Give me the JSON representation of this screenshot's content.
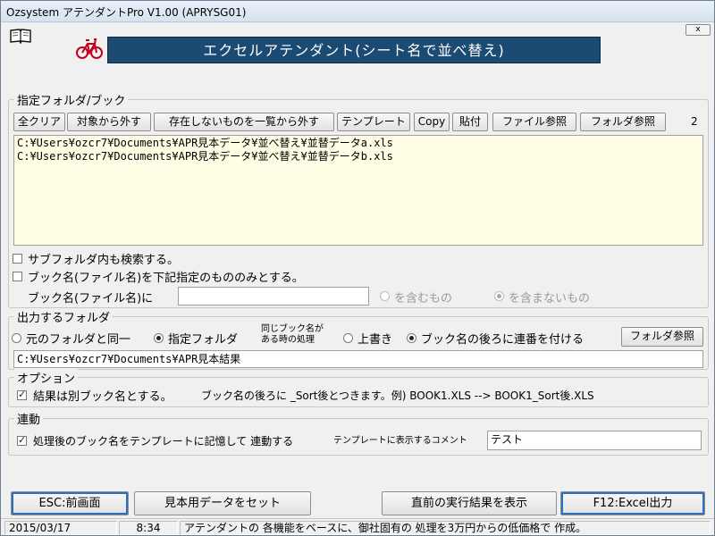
{
  "window": {
    "title": "Ozsystem アテンダントPro V1.00 (APRYSG01)",
    "close_label": "x"
  },
  "banner": {
    "title": "エクセルアテンダント(シート名で並べ替え)"
  },
  "icons": {
    "book": "book-icon",
    "bike": "bicycle-icon"
  },
  "folder_book_group": {
    "label": "指定フォルダ/ブック",
    "buttons": {
      "clear_all": "全クリア",
      "exclude": "対象から外す",
      "remove_missing": "存在しないものを一覧から外す",
      "template": "テンプレート",
      "copy": "Copy",
      "paste": "貼付",
      "file_browse": "ファイル参照",
      "folder_browse": "フォルダ参照"
    },
    "count": "2",
    "files": [
      "C:¥Users¥ozcr7¥Documents¥APR見本データ¥並べ替え¥並替データa.xls",
      "C:¥Users¥ozcr7¥Documents¥APR見本データ¥並べ替え¥並替データb.xls"
    ],
    "include_subfolders": {
      "label": "サブフォルダ内も検索する。",
      "checked": false
    },
    "book_name_filter": {
      "label": "ブック名(ファイル名)を下記指定のもののみとする。",
      "checked": false
    },
    "book_name_label": "ブック名(ファイル名)に",
    "book_name_value": "",
    "contains_label": "を含むもの",
    "not_contains_label": "を含まないもの",
    "selected_match": "not_contains"
  },
  "output_group": {
    "label": "出力するフォルダ",
    "same_folder_label": "元のフォルダと同一",
    "specified_folder_label": "指定フォルダ",
    "selected_folder": "specified",
    "same_name_label_line1": "同じブック名が",
    "same_name_label_line2": "ある時の処理",
    "overwrite_label": "上書き",
    "append_number_label": "ブック名の後ろに連番を付ける",
    "selected_same_name": "append_number",
    "folder_browse": "フォルダ参照",
    "output_path": "C:¥Users¥ozcr7¥Documents¥APR見本結果"
  },
  "option_group": {
    "label": "オプション",
    "separate_book": {
      "label": "結果は別ブック名とする。",
      "checked": true
    },
    "note": "ブック名の後ろに _Sort後とつきます。例) BOOK1.XLS --> BOOK1_Sort後.XLS"
  },
  "link_group": {
    "label": "連動",
    "remember": {
      "label": "処理後のブック名をテンプレートに記憶して 連動する",
      "checked": true
    },
    "comment_label": "テンプレートに表示するコメント",
    "comment_value": "テスト"
  },
  "footer_buttons": {
    "esc": "ESC:前画面",
    "sample_data": "見本用データをセット",
    "prev_results": "直前の実行結果を表示",
    "f12": "F12:Excel出力"
  },
  "statusbar": {
    "date": "2015/03/17",
    "time": "8:34",
    "message": "アテンダントの 各機能をベースに、御社固有の 処理を3万円からの低価格で 作成。"
  }
}
